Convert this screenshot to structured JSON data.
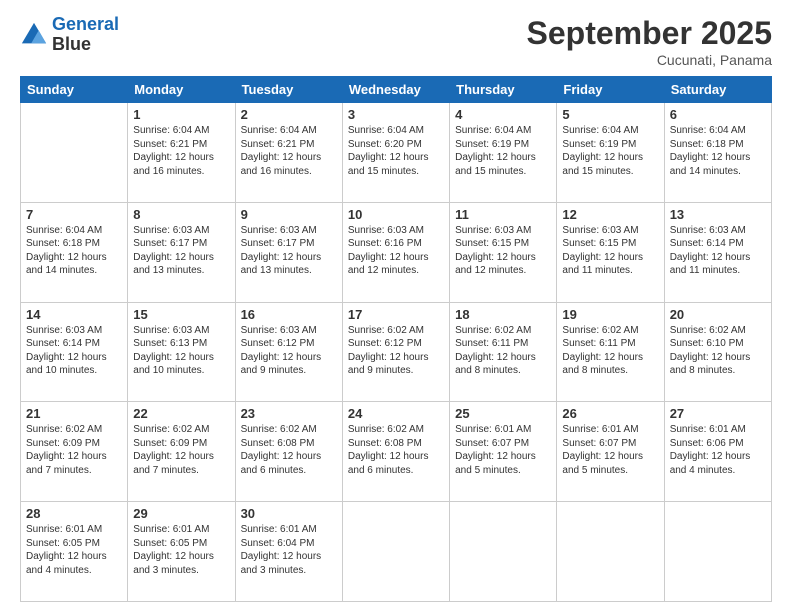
{
  "header": {
    "logo_line1": "General",
    "logo_line2": "Blue",
    "month": "September 2025",
    "location": "Cucunati, Panama"
  },
  "days_of_week": [
    "Sunday",
    "Monday",
    "Tuesday",
    "Wednesday",
    "Thursday",
    "Friday",
    "Saturday"
  ],
  "weeks": [
    [
      {
        "day": "",
        "info": ""
      },
      {
        "day": "1",
        "info": "Sunrise: 6:04 AM\nSunset: 6:21 PM\nDaylight: 12 hours\nand 16 minutes."
      },
      {
        "day": "2",
        "info": "Sunrise: 6:04 AM\nSunset: 6:21 PM\nDaylight: 12 hours\nand 16 minutes."
      },
      {
        "day": "3",
        "info": "Sunrise: 6:04 AM\nSunset: 6:20 PM\nDaylight: 12 hours\nand 15 minutes."
      },
      {
        "day": "4",
        "info": "Sunrise: 6:04 AM\nSunset: 6:19 PM\nDaylight: 12 hours\nand 15 minutes."
      },
      {
        "day": "5",
        "info": "Sunrise: 6:04 AM\nSunset: 6:19 PM\nDaylight: 12 hours\nand 15 minutes."
      },
      {
        "day": "6",
        "info": "Sunrise: 6:04 AM\nSunset: 6:18 PM\nDaylight: 12 hours\nand 14 minutes."
      }
    ],
    [
      {
        "day": "7",
        "info": "Sunrise: 6:04 AM\nSunset: 6:18 PM\nDaylight: 12 hours\nand 14 minutes."
      },
      {
        "day": "8",
        "info": "Sunrise: 6:03 AM\nSunset: 6:17 PM\nDaylight: 12 hours\nand 13 minutes."
      },
      {
        "day": "9",
        "info": "Sunrise: 6:03 AM\nSunset: 6:17 PM\nDaylight: 12 hours\nand 13 minutes."
      },
      {
        "day": "10",
        "info": "Sunrise: 6:03 AM\nSunset: 6:16 PM\nDaylight: 12 hours\nand 12 minutes."
      },
      {
        "day": "11",
        "info": "Sunrise: 6:03 AM\nSunset: 6:15 PM\nDaylight: 12 hours\nand 12 minutes."
      },
      {
        "day": "12",
        "info": "Sunrise: 6:03 AM\nSunset: 6:15 PM\nDaylight: 12 hours\nand 11 minutes."
      },
      {
        "day": "13",
        "info": "Sunrise: 6:03 AM\nSunset: 6:14 PM\nDaylight: 12 hours\nand 11 minutes."
      }
    ],
    [
      {
        "day": "14",
        "info": "Sunrise: 6:03 AM\nSunset: 6:14 PM\nDaylight: 12 hours\nand 10 minutes."
      },
      {
        "day": "15",
        "info": "Sunrise: 6:03 AM\nSunset: 6:13 PM\nDaylight: 12 hours\nand 10 minutes."
      },
      {
        "day": "16",
        "info": "Sunrise: 6:03 AM\nSunset: 6:12 PM\nDaylight: 12 hours\nand 9 minutes."
      },
      {
        "day": "17",
        "info": "Sunrise: 6:02 AM\nSunset: 6:12 PM\nDaylight: 12 hours\nand 9 minutes."
      },
      {
        "day": "18",
        "info": "Sunrise: 6:02 AM\nSunset: 6:11 PM\nDaylight: 12 hours\nand 8 minutes."
      },
      {
        "day": "19",
        "info": "Sunrise: 6:02 AM\nSunset: 6:11 PM\nDaylight: 12 hours\nand 8 minutes."
      },
      {
        "day": "20",
        "info": "Sunrise: 6:02 AM\nSunset: 6:10 PM\nDaylight: 12 hours\nand 8 minutes."
      }
    ],
    [
      {
        "day": "21",
        "info": "Sunrise: 6:02 AM\nSunset: 6:09 PM\nDaylight: 12 hours\nand 7 minutes."
      },
      {
        "day": "22",
        "info": "Sunrise: 6:02 AM\nSunset: 6:09 PM\nDaylight: 12 hours\nand 7 minutes."
      },
      {
        "day": "23",
        "info": "Sunrise: 6:02 AM\nSunset: 6:08 PM\nDaylight: 12 hours\nand 6 minutes."
      },
      {
        "day": "24",
        "info": "Sunrise: 6:02 AM\nSunset: 6:08 PM\nDaylight: 12 hours\nand 6 minutes."
      },
      {
        "day": "25",
        "info": "Sunrise: 6:01 AM\nSunset: 6:07 PM\nDaylight: 12 hours\nand 5 minutes."
      },
      {
        "day": "26",
        "info": "Sunrise: 6:01 AM\nSunset: 6:07 PM\nDaylight: 12 hours\nand 5 minutes."
      },
      {
        "day": "27",
        "info": "Sunrise: 6:01 AM\nSunset: 6:06 PM\nDaylight: 12 hours\nand 4 minutes."
      }
    ],
    [
      {
        "day": "28",
        "info": "Sunrise: 6:01 AM\nSunset: 6:05 PM\nDaylight: 12 hours\nand 4 minutes."
      },
      {
        "day": "29",
        "info": "Sunrise: 6:01 AM\nSunset: 6:05 PM\nDaylight: 12 hours\nand 3 minutes."
      },
      {
        "day": "30",
        "info": "Sunrise: 6:01 AM\nSunset: 6:04 PM\nDaylight: 12 hours\nand 3 minutes."
      },
      {
        "day": "",
        "info": ""
      },
      {
        "day": "",
        "info": ""
      },
      {
        "day": "",
        "info": ""
      },
      {
        "day": "",
        "info": ""
      }
    ]
  ]
}
